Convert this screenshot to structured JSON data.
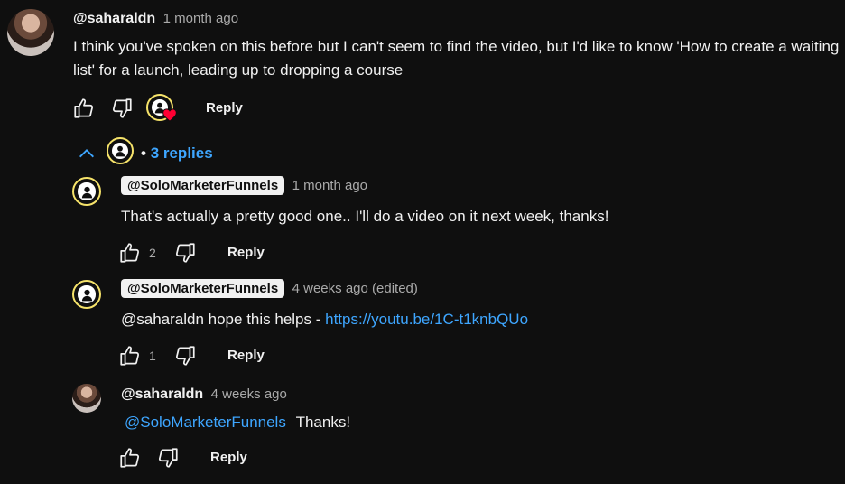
{
  "main_comment": {
    "author": "@saharaldn",
    "time": "1 month ago",
    "text": "I think you've spoken on this before but I can't seem to find the video, but I'd like to know 'How to create a waiting list' for a launch, leading up to dropping a course",
    "reply_label": "Reply"
  },
  "replies_toggle": {
    "bullet": "•",
    "label": "3 replies"
  },
  "replies": [
    {
      "author": "@SoloMarketerFunnels",
      "time": "1 month ago",
      "text": "That's actually a pretty good one.. I'll do a video on it next week, thanks!",
      "likes": "2",
      "reply_label": "Reply"
    },
    {
      "author": "@SoloMarketerFunnels",
      "time": "4 weeks ago (edited)",
      "text_prefix": "@saharaldn hope this helps - ",
      "link": "https://youtu.be/1C-t1knbQUo",
      "likes": "1",
      "reply_label": "Reply"
    },
    {
      "author": "@saharaldn",
      "time": "4 weeks ago",
      "mention": "@SoloMarketerFunnels",
      "text_suffix": "Thanks!",
      "reply_label": "Reply"
    }
  ],
  "colors": {
    "background": "#0f0f0f",
    "link": "#3ea6ff",
    "creator_ring": "#f6e36a",
    "heart": "#ff0033"
  }
}
